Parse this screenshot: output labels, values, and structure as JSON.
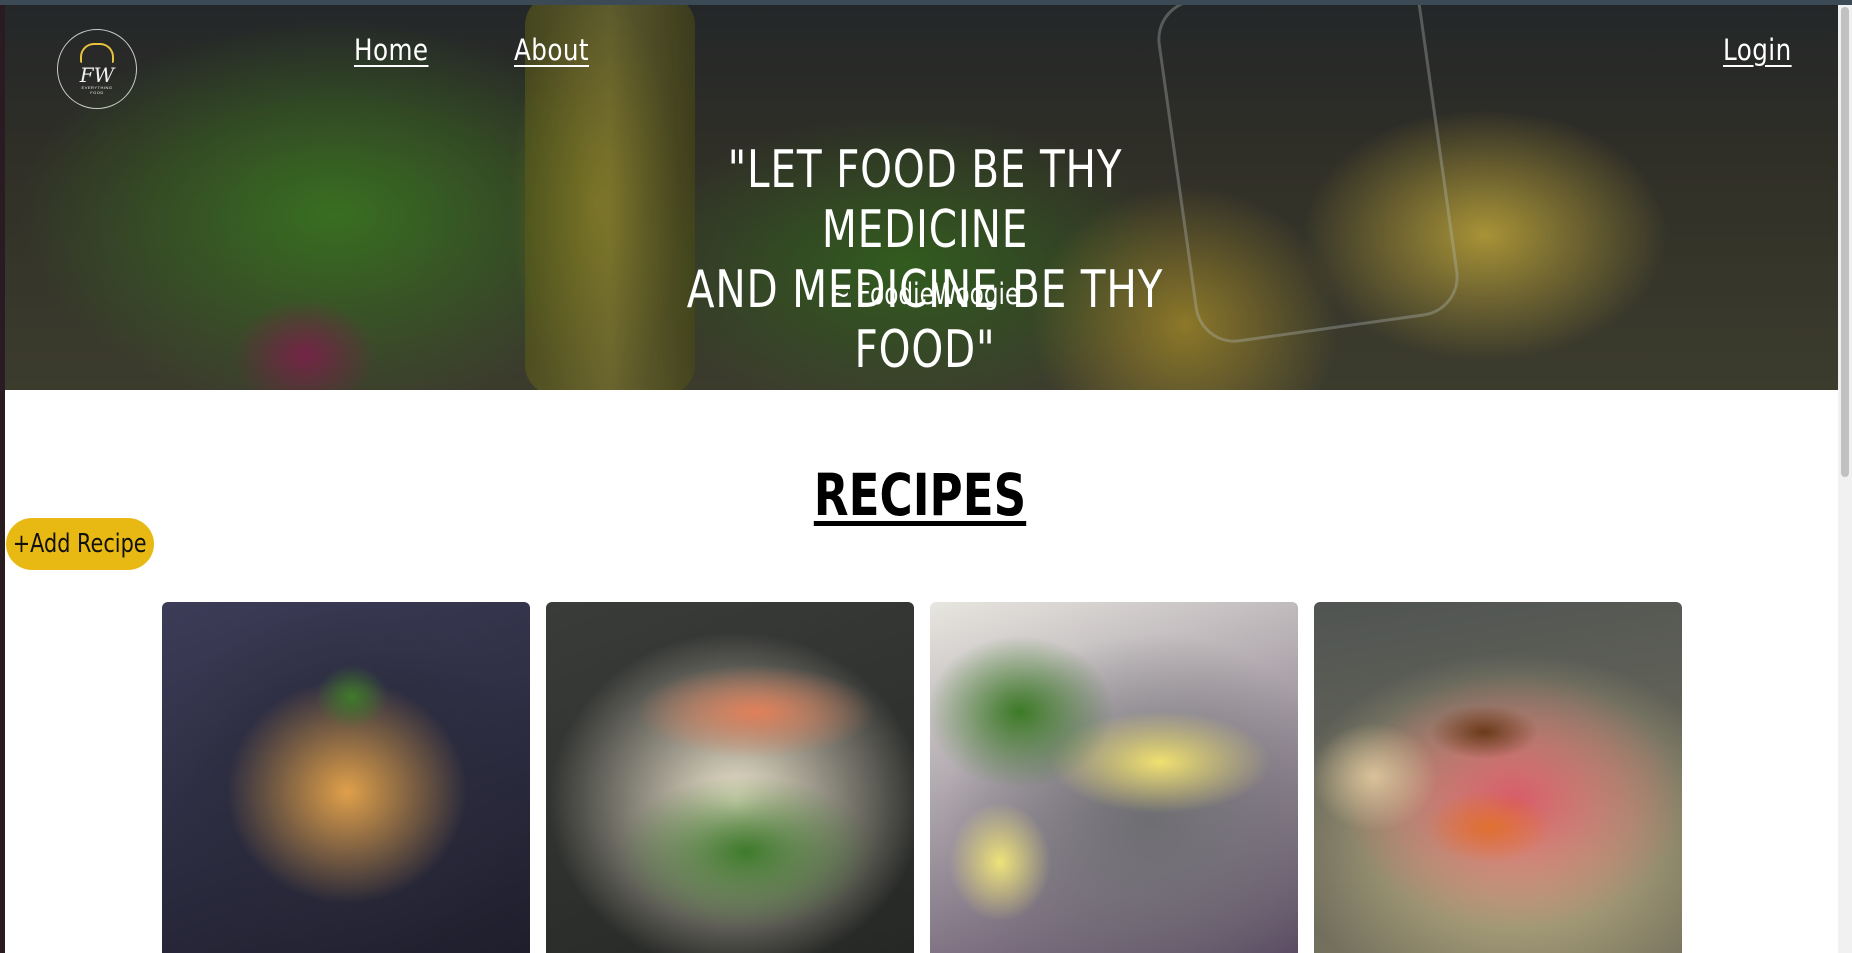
{
  "nav": {
    "logo_mark": "FW",
    "logo_text": "EVERYTHING FOOD",
    "home_label": "Home",
    "about_label": "About",
    "login_label": "Login"
  },
  "hero": {
    "quote_line1": "\"LET FOOD BE THY MEDICINE",
    "quote_line2": "AND MEDICINE BE THY FOOD\"",
    "author": "~ FoodieWoogie"
  },
  "recipes": {
    "title": "RECIPES",
    "add_button_label": "+Add Recipe",
    "cards": [
      {
        "image": "pasta-dish"
      },
      {
        "image": "salmon-salad"
      },
      {
        "image": "omelette-greens"
      },
      {
        "image": "bread-beans-vegetables"
      }
    ]
  },
  "colors": {
    "accent": "#e8b913",
    "text": "#000000",
    "hero_text": "#ffffff"
  }
}
